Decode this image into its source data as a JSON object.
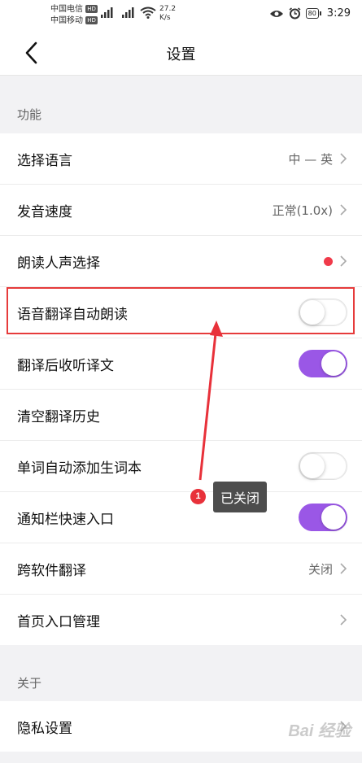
{
  "status_bar": {
    "carrier1": "中国电信",
    "carrier2": "中国移动",
    "hd": "HD",
    "net_speed": "27.2",
    "net_unit": "K/s",
    "battery": "80",
    "time": "3:29"
  },
  "nav": {
    "title": "设置"
  },
  "sections": {
    "features": "功能",
    "about": "关于"
  },
  "rows": {
    "language": {
      "label": "选择语言",
      "value": "中 — 英"
    },
    "speed": {
      "label": "发音速度",
      "value": "正常(1.0x)"
    },
    "voice": {
      "label": "朗读人声选择"
    },
    "auto_read": {
      "label": "语音翻译自动朗读",
      "toggle": "off"
    },
    "listen": {
      "label": "翻译后收听译文",
      "toggle": "on"
    },
    "clear_history": {
      "label": "清空翻译历史"
    },
    "auto_add": {
      "label": "单词自动添加生词本",
      "toggle": "off"
    },
    "notify": {
      "label": "通知栏快速入口",
      "toggle": "on"
    },
    "cross_app": {
      "label": "跨软件翻译",
      "value": "关闭"
    },
    "home_entry": {
      "label": "首页入口管理"
    },
    "privacy": {
      "label": "隐私设置"
    }
  },
  "annotation": {
    "badge": "1",
    "tooltip": "已关闭"
  },
  "colors": {
    "accent": "#9a57e6",
    "highlight": "#e63b3b",
    "dot": "#f03a4a"
  },
  "watermark": "Bai 经验"
}
